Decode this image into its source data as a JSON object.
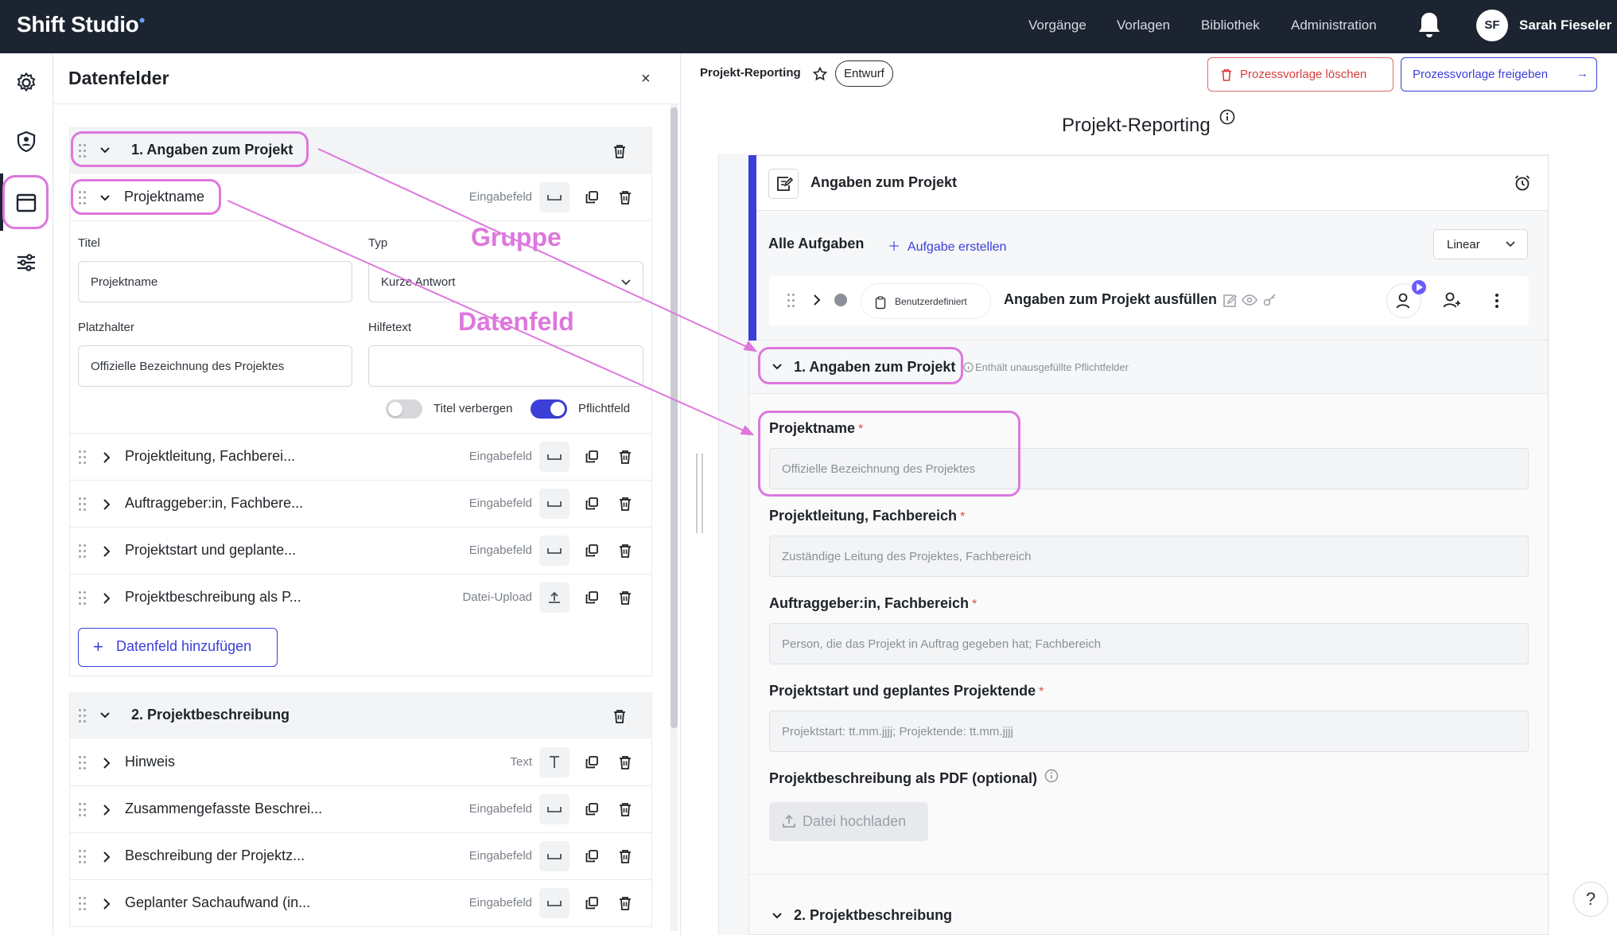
{
  "app": {
    "name": "Shift Studio"
  },
  "topnav": {
    "items": [
      "Vorgänge",
      "Vorlagen",
      "Bibliothek",
      "Administration"
    ]
  },
  "user": {
    "initials": "SF",
    "name": "Sarah Fieseler"
  },
  "left_panel": {
    "title": "Datenfelder",
    "close": "×",
    "groups": [
      {
        "title": "1. Angaben zum Projekt",
        "fields": [
          {
            "label": "Projektname",
            "type": "Eingabefeld",
            "expanded": true
          },
          {
            "label": "Projektleitung, Fachberei...",
            "type": "Eingabefeld"
          },
          {
            "label": "Auftraggeber:in, Fachbere...",
            "type": "Eingabefeld"
          },
          {
            "label": "Projektstart und geplante...",
            "type": "Eingabefeld"
          },
          {
            "label": "Projektbeschreibung als P...",
            "type": "Datei-Upload"
          }
        ]
      },
      {
        "title": "2. Projektbeschreibung",
        "fields": [
          {
            "label": "Hinweis",
            "type": "Text"
          },
          {
            "label": "Zusammengefasste Beschrei...",
            "type": "Eingabefeld"
          },
          {
            "label": "Beschreibung der Projektz...",
            "type": "Eingabefeld"
          },
          {
            "label": "Geplanter Sachaufwand (in...",
            "type": "Eingabefeld"
          }
        ]
      }
    ],
    "editor": {
      "titel_label": "Titel",
      "titel_value": "Projektname",
      "typ_label": "Typ",
      "typ_value": "Kurze Antwort",
      "platzhalter_label": "Platzhalter",
      "platzhalter_value": "Offizielle Bezeichnung des Projektes",
      "hilfetext_label": "Hilfetext",
      "hilfetext_value": "",
      "toggle_hide_title": {
        "label": "Titel verbergen",
        "on": false
      },
      "toggle_required": {
        "label": "Pflichtfeld",
        "on": true
      }
    },
    "add_field": "Datenfeld hinzufügen"
  },
  "header": {
    "breadcrumb": "Projekt-Reporting",
    "status": "Entwurf",
    "delete_btn": "Prozessvorlage löschen",
    "release_btn": "Prozessvorlage freigeben"
  },
  "document": {
    "title": "Projekt-Reporting",
    "section_title": "Angaben zum Projekt",
    "tasks_title": "Alle Aufgaben",
    "create_task": "Aufgabe erstellen",
    "mode": "Linear",
    "task": {
      "chip": "Benutzerdefiniert",
      "name": "Angaben zum Projekt ausfüllen"
    },
    "group1": {
      "title": "1. Angaben zum Projekt",
      "note": "Enthält unausgefüllte Pflichtfelder"
    },
    "fields": [
      {
        "label": "Projektname",
        "placeholder": "Offizielle Bezeichnung des Projektes",
        "required": "*"
      },
      {
        "label": "Projektleitung, Fachbereich",
        "placeholder": "Zuständige Leitung des Projektes, Fachbereich",
        "required": "*"
      },
      {
        "label": "Auftraggeber:in, Fachbereich",
        "placeholder": "Person, die das Projekt in Auftrag gegeben hat; Fachbereich",
        "required": "*"
      },
      {
        "label": "Projektstart und geplantes Projektende",
        "placeholder": "Projektstart: tt.mm.jjjj; Projektende: tt.mm.jjjj",
        "required": "*"
      }
    ],
    "upload_label": "Projektbeschreibung als PDF (optional)",
    "upload_btn": "Datei hochladen",
    "group2": {
      "title": "2. Projektbeschreibung"
    }
  },
  "annotations": {
    "group": "Gruppe",
    "field": "Datenfeld"
  },
  "help": "?",
  "colors": {
    "topbar": "#1c2431",
    "accent": "#3b3fd8",
    "annotation": "#dd77dd",
    "danger": "#d93c3c"
  }
}
